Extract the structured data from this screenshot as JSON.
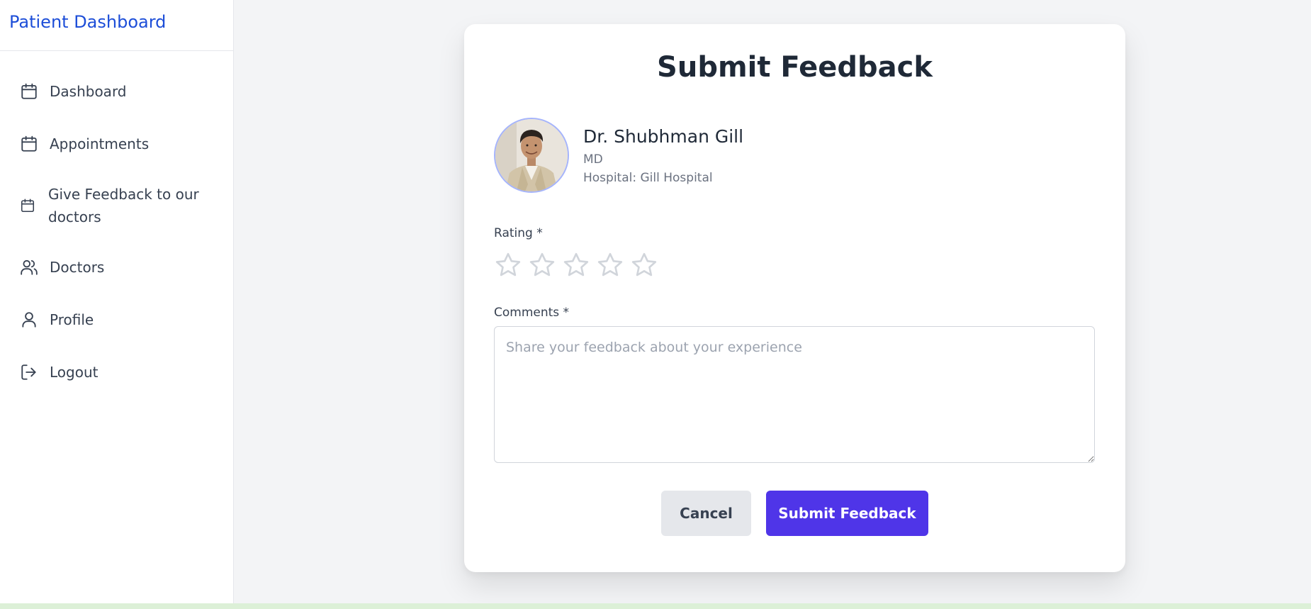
{
  "sidebar": {
    "brand": "Patient Dashboard",
    "items": [
      {
        "label": "Dashboard",
        "icon": "calendar-icon"
      },
      {
        "label": "Appointments",
        "icon": "calendar-icon"
      },
      {
        "label": "Give Feedback to our doctors",
        "icon": "calendar-icon"
      },
      {
        "label": "Doctors",
        "icon": "users-icon"
      },
      {
        "label": "Profile",
        "icon": "user-icon"
      },
      {
        "label": "Logout",
        "icon": "logout-icon"
      }
    ]
  },
  "form": {
    "title": "Submit Feedback",
    "doctor": {
      "name": "Dr. Shubhman Gill",
      "degree": "MD",
      "hospital": "Hospital: Gill Hospital"
    },
    "rating_label": "Rating *",
    "rating_value": 0,
    "rating_max": 5,
    "comments_label": "Comments *",
    "comments_placeholder": "Share your feedback about your experience",
    "comments_value": "",
    "cancel_label": "Cancel",
    "submit_label": "Submit Feedback"
  },
  "colors": {
    "brand": "#1d4ed8",
    "primary_button": "#4f35e8",
    "secondary_button": "#e5e7eb",
    "star_empty": "#d1d5db"
  }
}
